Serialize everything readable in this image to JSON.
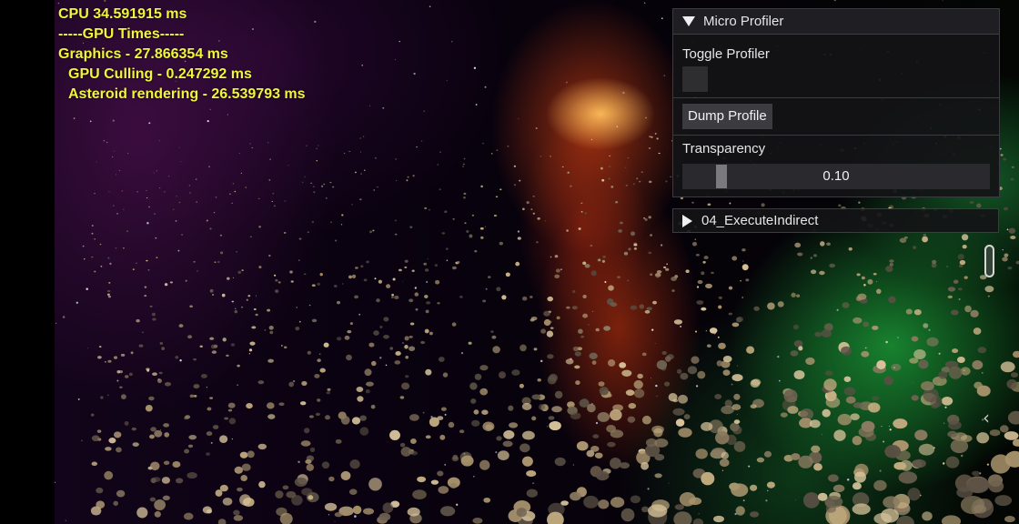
{
  "stats": {
    "cpu": "CPU 34.591915 ms",
    "gpu_header": "-----GPU Times-----",
    "graphics": "Graphics - 27.866354 ms",
    "gpu_culling": "GPU Culling - 0.247292 ms",
    "asteroid_rendering": "Asteroid rendering - 26.539793 ms"
  },
  "profiler": {
    "title": "Micro Profiler",
    "toggle_label": "Toggle Profiler",
    "toggle_checked": false,
    "dump_button": "Dump Profile",
    "transparency_label": "Transparency",
    "transparency_value": "0.10"
  },
  "sample_panel": {
    "title": "04_ExecuteIndirect"
  },
  "icons": {
    "collapse": "triangle-down-icon",
    "expand": "triangle-right-icon",
    "back": "chevron-left-icon"
  },
  "colors": {
    "stats_text": "#f2f53c",
    "panel_bg": "#141416",
    "panel_text": "#e6e6e6"
  }
}
